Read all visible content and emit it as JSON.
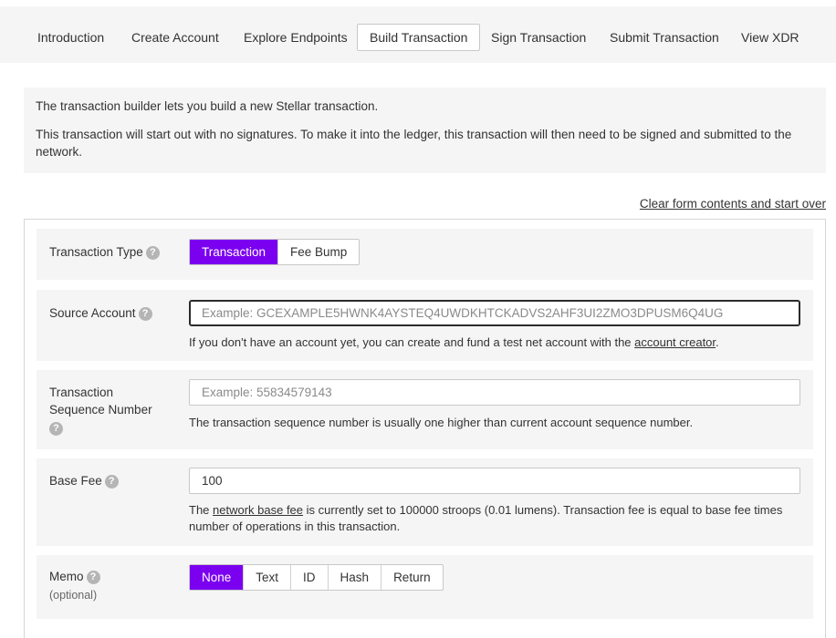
{
  "nav": {
    "tabs": [
      {
        "label": "Introduction"
      },
      {
        "label": "Create Account"
      },
      {
        "label": "Explore Endpoints"
      },
      {
        "label": "Build Transaction"
      },
      {
        "label": "Sign Transaction"
      },
      {
        "label": "Submit Transaction"
      },
      {
        "label": "View XDR"
      }
    ],
    "active": "Build Transaction"
  },
  "intro": {
    "line1": "The transaction builder lets you build a new Stellar transaction.",
    "line2": "This transaction will start out with no signatures. To make it into the ledger, this transaction will then need to be signed and submitted to the network."
  },
  "clear_link": "Clear form contents and start over",
  "form": {
    "transaction_type": {
      "label": "Transaction Type",
      "options": [
        "Transaction",
        "Fee Bump"
      ],
      "selected": "Transaction"
    },
    "source_account": {
      "label": "Source Account",
      "placeholder": "Example: GCEXAMPLE5HWNK4AYSTEQ4UWDKHTCKADVS2AHF3UI2ZMO3DPUSM6Q4UG",
      "value": "",
      "note_before": "If you don't have an account yet, you can create and fund a test net account with the ",
      "note_link": "account creator",
      "note_after": "."
    },
    "sequence_number": {
      "label_line1": "Transaction",
      "label_line2": "Sequence Number",
      "placeholder": "Example: 55834579143",
      "value": "",
      "note": "The transaction sequence number is usually one higher than current account sequence number."
    },
    "base_fee": {
      "label": "Base Fee",
      "value": "100",
      "note_before": "The ",
      "note_link": "network base fee",
      "note_after": " is currently set to 100000 stroops (0.01 lumens). Transaction fee is equal to base fee times number of operations in this transaction."
    },
    "memo": {
      "label": "Memo",
      "sublabel": "(optional)",
      "options": [
        "None",
        "Text",
        "ID",
        "Hash",
        "Return"
      ],
      "selected": "None"
    },
    "help_icon_glyph": "?"
  },
  "colors": {
    "accent": "#7b00f0",
    "panel": "#f5f5f5"
  }
}
